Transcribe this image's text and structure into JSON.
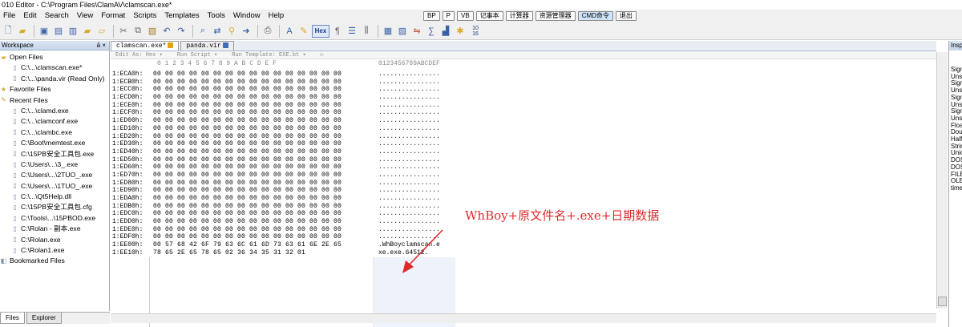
{
  "window": {
    "title": "010 Editor - C:\\Program Files\\ClamAV\\clamscan.exe*"
  },
  "menu": [
    "File",
    "Edit",
    "Search",
    "View",
    "Format",
    "Scripts",
    "Templates",
    "Tools",
    "Window",
    "Help"
  ],
  "quick_buttons": [
    {
      "label": "BP",
      "selected": false
    },
    {
      "label": "P",
      "selected": false
    },
    {
      "label": "VB",
      "selected": false
    },
    {
      "label": "记事本",
      "selected": false
    },
    {
      "label": "计算器",
      "selected": false
    },
    {
      "label": "资源管理器",
      "selected": false
    },
    {
      "label": "CMD命令",
      "selected": true
    },
    {
      "label": "退出",
      "selected": false
    }
  ],
  "toolbar": {
    "hex_label": "Hex",
    "badge_top": "10",
    "badge_bottom": "16"
  },
  "workspace": {
    "title": "Workspace",
    "pin": "ā ×",
    "open_files_label": "Open Files",
    "open_files": [
      "C:\\...\\clamscan.exe*",
      "C:\\...\\panda.vir (Read Only)"
    ],
    "favorite_label": "Favorite Files",
    "recent_label": "Recent Files",
    "recent_files": [
      "C:\\...\\clamd.exe",
      "C:\\...\\clamconf.exe",
      "C:\\...\\clambc.exe",
      "C:\\Boot\\memtest.exe",
      "C:\\15PB安全工具包.exe",
      "C:\\Users\\...\\3_.exe",
      "C:\\Users\\...\\2TUO_.exe",
      "C:\\Users\\...\\1TUO_.exe",
      "C:\\...\\Qt5Help.dll",
      "C:\\15PB安全工具包.cfg",
      "C:\\Tools\\...\\15PBOD.exe",
      "C:\\Rolan - 副本.exe",
      "C:\\Rolan.exe",
      "C:\\Rolan1.exe"
    ],
    "bookmarked_label": "Bookmarked Files"
  },
  "bottom_tabs": [
    "Files",
    "Explorer"
  ],
  "editor": {
    "tabs": [
      {
        "label": "clamscan.exe*"
      },
      {
        "label": "panda.vir"
      }
    ],
    "info": [
      "Edit As: Hex ▾",
      "Run Script ▾",
      "Run Template: EXE.bt ▾",
      "▷"
    ],
    "col_header_hex": "0  1  2  3  4  5  6  7  8  9  A  B  C  D  E  F",
    "col_header_ascii": "0123456789ABCDEF",
    "rows": [
      {
        "addr": "1:ECA0h:",
        "bytes": "00 00 00 00 00 00 00 00 00 00 00 00 00 00 00 00",
        "ascii": "................"
      },
      {
        "addr": "1:ECB0h:",
        "bytes": "00 00 00 00 00 00 00 00 00 00 00 00 00 00 00 00",
        "ascii": "................"
      },
      {
        "addr": "1:ECC0h:",
        "bytes": "00 00 00 00 00 00 00 00 00 00 00 00 00 00 00 00",
        "ascii": "................"
      },
      {
        "addr": "1:ECD0h:",
        "bytes": "00 00 00 00 00 00 00 00 00 00 00 00 00 00 00 00",
        "ascii": "................"
      },
      {
        "addr": "1:ECE0h:",
        "bytes": "00 00 00 00 00 00 00 00 00 00 00 00 00 00 00 00",
        "ascii": "................"
      },
      {
        "addr": "1:ECF0h:",
        "bytes": "00 00 00 00 00 00 00 00 00 00 00 00 00 00 00 00",
        "ascii": "................"
      },
      {
        "addr": "1:ED00h:",
        "bytes": "00 00 00 00 00 00 00 00 00 00 00 00 00 00 00 00",
        "ascii": "................"
      },
      {
        "addr": "1:ED10h:",
        "bytes": "00 00 00 00 00 00 00 00 00 00 00 00 00 00 00 00",
        "ascii": "................"
      },
      {
        "addr": "1:ED20h:",
        "bytes": "00 00 00 00 00 00 00 00 00 00 00 00 00 00 00 00",
        "ascii": "................"
      },
      {
        "addr": "1:ED30h:",
        "bytes": "00 00 00 00 00 00 00 00 00 00 00 00 00 00 00 00",
        "ascii": "................"
      },
      {
        "addr": "1:ED40h:",
        "bytes": "00 00 00 00 00 00 00 00 00 00 00 00 00 00 00 00",
        "ascii": "................"
      },
      {
        "addr": "1:ED50h:",
        "bytes": "00 00 00 00 00 00 00 00 00 00 00 00 00 00 00 00",
        "ascii": "................"
      },
      {
        "addr": "1:ED60h:",
        "bytes": "00 00 00 00 00 00 00 00 00 00 00 00 00 00 00 00",
        "ascii": "................"
      },
      {
        "addr": "1:ED70h:",
        "bytes": "00 00 00 00 00 00 00 00 00 00 00 00 00 00 00 00",
        "ascii": "................"
      },
      {
        "addr": "1:ED80h:",
        "bytes": "00 00 00 00 00 00 00 00 00 00 00 00 00 00 00 00",
        "ascii": "................"
      },
      {
        "addr": "1:ED90h:",
        "bytes": "00 00 00 00 00 00 00 00 00 00 00 00 00 00 00 00",
        "ascii": "................"
      },
      {
        "addr": "1:EDA0h:",
        "bytes": "00 00 00 00 00 00 00 00 00 00 00 00 00 00 00 00",
        "ascii": "................"
      },
      {
        "addr": "1:EDB0h:",
        "bytes": "00 00 00 00 00 00 00 00 00 00 00 00 00 00 00 00",
        "ascii": "................"
      },
      {
        "addr": "1:EDC0h:",
        "bytes": "00 00 00 00 00 00 00 00 00 00 00 00 00 00 00 00",
        "ascii": "................"
      },
      {
        "addr": "1:EDD0h:",
        "bytes": "00 00 00 00 00 00 00 00 00 00 00 00 00 00 00 00",
        "ascii": "................"
      },
      {
        "addr": "1:EDE0h:",
        "bytes": "00 00 00 00 00 00 00 00 00 00 00 00 00 00 00 00",
        "ascii": "................"
      },
      {
        "addr": "1:EDF0h:",
        "bytes": "00 00 00 00 00 00 00 00 00 00 00 00 00 00 00 00",
        "ascii": "................"
      },
      {
        "addr": "1:EE00h:",
        "bytes": "00 57 68 42 6F 79 63 6C 61 6D 73 63 61 6E 2E 65",
        "ascii": ".WhBoyclamscan.e"
      },
      {
        "addr": "1:EE10h:",
        "bytes": "78 65 2E 65 78 65 02 36 34 35 31 32 01",
        "ascii": "xe.exe.64512."
      }
    ],
    "annotation": "WhBoy+原文件名+.exe+日期数据"
  },
  "inspector": {
    "title": "Insp",
    "items": [
      "Sign",
      "Uns",
      "Sign",
      "Uns",
      "Sign",
      "Uns",
      "Sign",
      "Uns",
      "Floa",
      "Dou",
      "Half",
      "Strin",
      "Unic",
      "DOS",
      "DOS",
      "FILE",
      "OLE",
      "time"
    ]
  },
  "colors": {
    "annotation": "#e0292b",
    "stripe": "#eef2fb",
    "hex_button_bg": "#dfe9f7"
  }
}
